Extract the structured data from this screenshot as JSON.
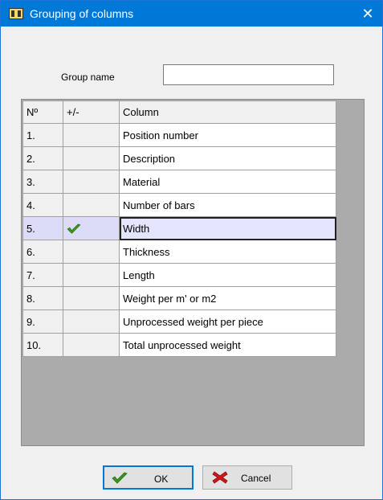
{
  "window": {
    "title": "Grouping of columns",
    "close_glyph": "✕"
  },
  "form": {
    "group_name_label": "Group name",
    "group_name_value": ""
  },
  "table": {
    "headers": [
      "Nº",
      "+/-",
      "Column"
    ],
    "rows": [
      {
        "no": "1.",
        "flag": false,
        "name": "Position number"
      },
      {
        "no": "2.",
        "flag": false,
        "name": "Description"
      },
      {
        "no": "3.",
        "flag": false,
        "name": "Material"
      },
      {
        "no": "4.",
        "flag": false,
        "name": "Number of bars"
      },
      {
        "no": "5.",
        "flag": true,
        "name": "Width",
        "selected": true
      },
      {
        "no": "6.",
        "flag": false,
        "name": "Thickness"
      },
      {
        "no": "7.",
        "flag": false,
        "name": "Length"
      },
      {
        "no": "8.",
        "flag": false,
        "name": "Weight per m' or m2"
      },
      {
        "no": "9.",
        "flag": false,
        "name": "Unprocessed weight per piece"
      },
      {
        "no": "10.",
        "flag": false,
        "name": "Total unprocessed weight"
      }
    ]
  },
  "buttons": {
    "ok_label": "OK",
    "cancel_label": "Cancel"
  },
  "icons": {
    "check": "check-icon",
    "cross": "cross-icon",
    "app": "app-icon"
  },
  "colors": {
    "titlebar": "#0078d7",
    "check": "#3a9a1a",
    "cross": "#d01818",
    "selected_row": "#e4e4fc"
  }
}
